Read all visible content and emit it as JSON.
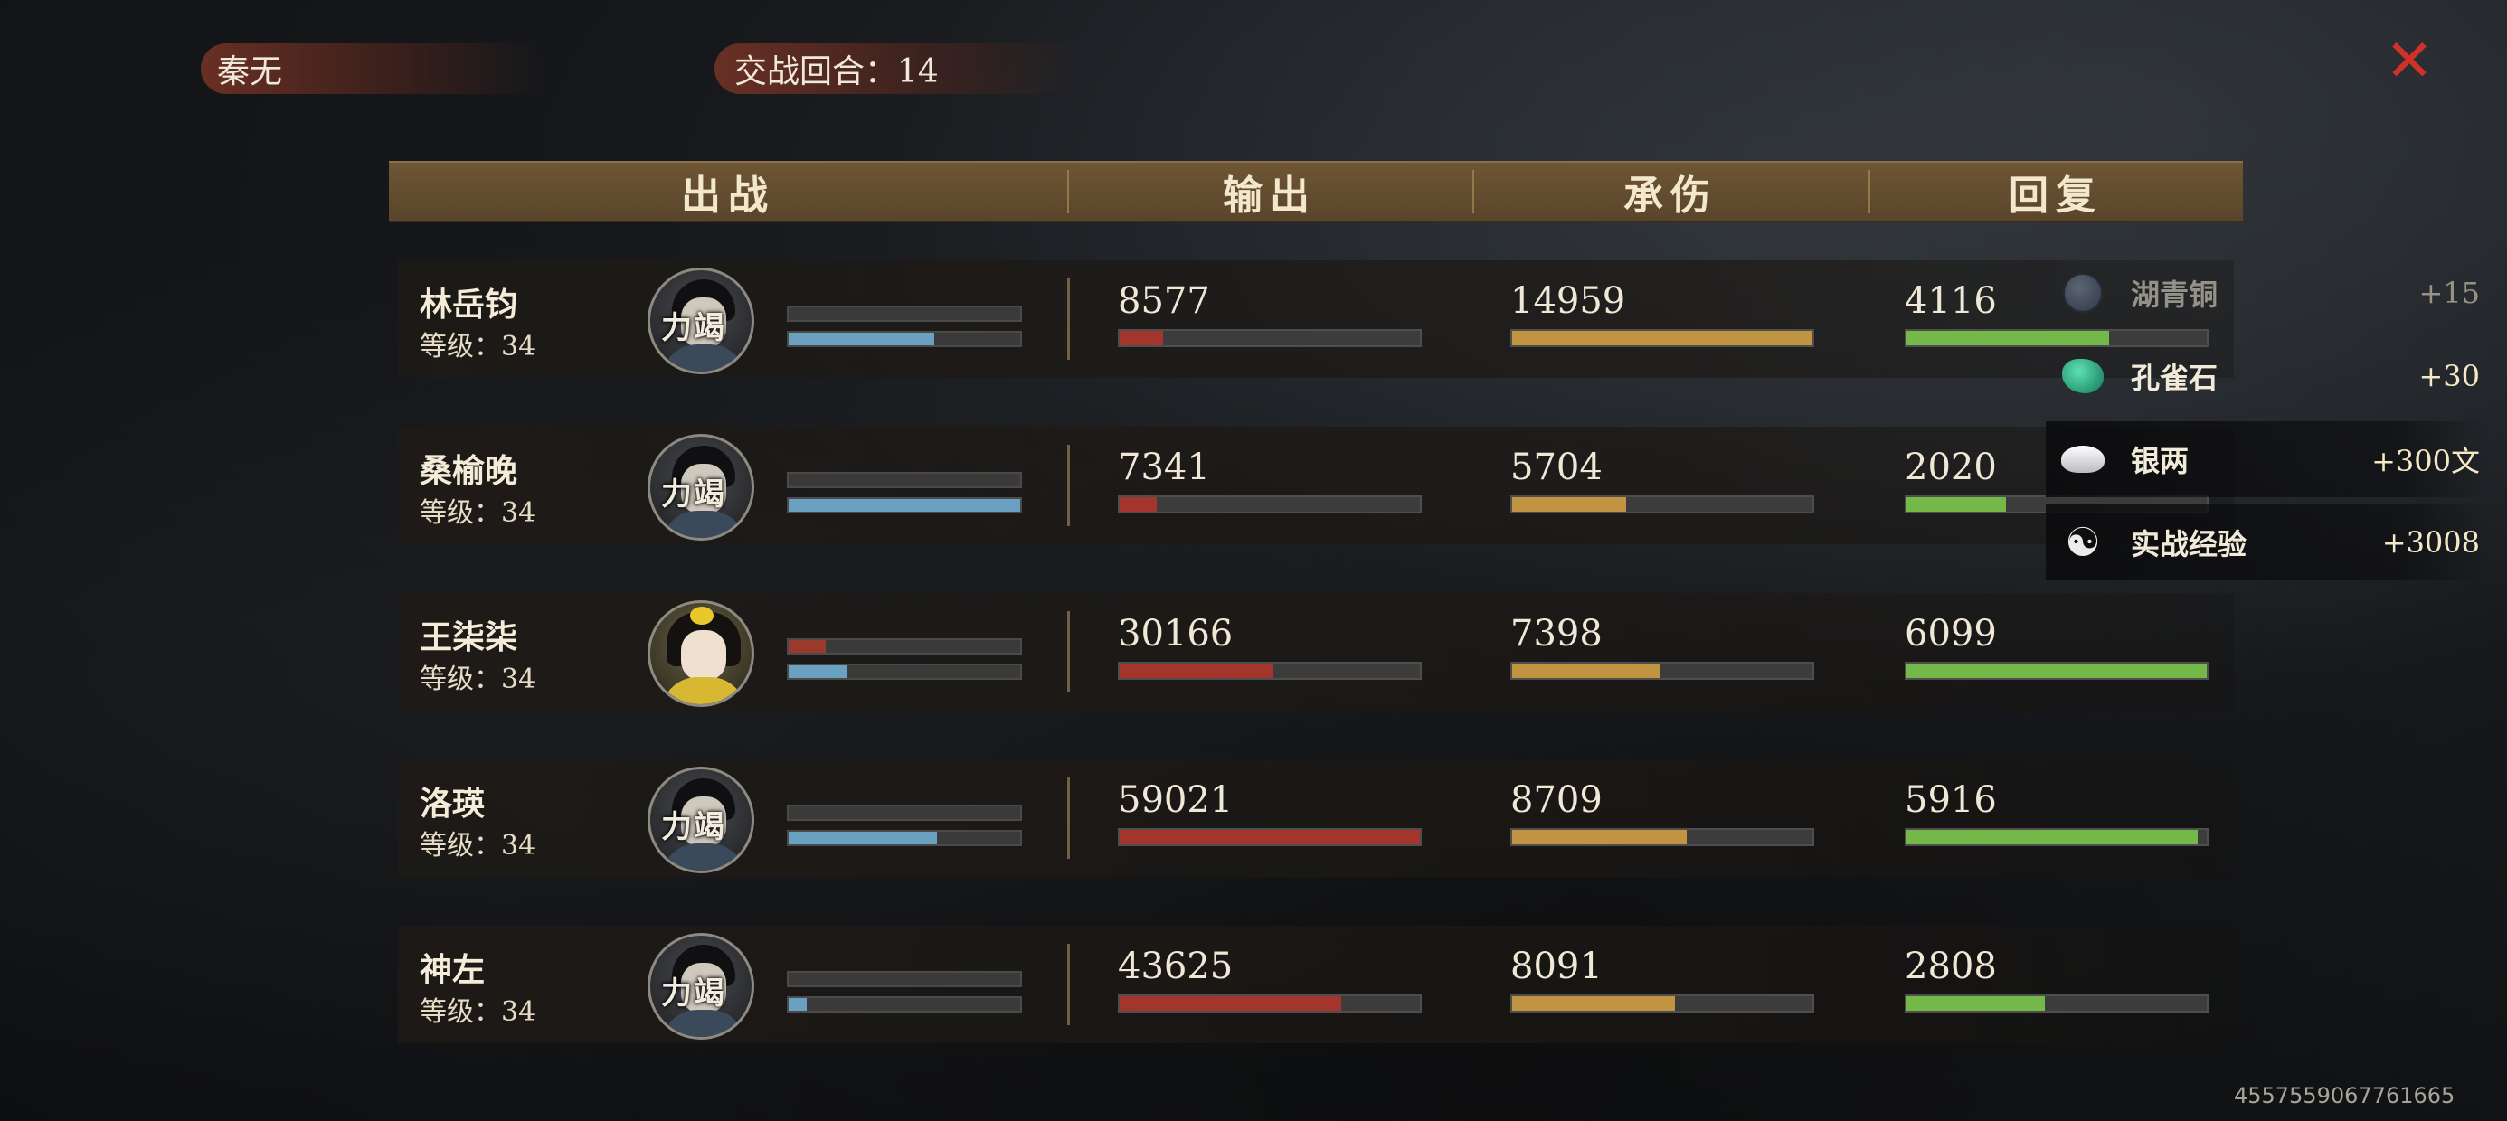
{
  "player": {
    "name": "秦无"
  },
  "battle": {
    "rounds_label": "交战回合：14"
  },
  "close_icon": "✕",
  "headers": [
    "出战",
    "输出",
    "承伤",
    "回复"
  ],
  "colors": {
    "output": "#a4352d",
    "tank": "#c19442",
    "heal": "#74b84a",
    "mini_red": "#9a3a2c",
    "mini_blue": "#6aa0c0"
  },
  "rows": [
    {
      "name": "林岳钧",
      "level": "等级：34",
      "avatar_mark": "力竭",
      "avatar_type": "male",
      "mini_top": 0,
      "mini_bot": 0.63,
      "output": "8577",
      "output_pct": 0.145,
      "tank": "14959",
      "tank_pct": 1.0,
      "heal": "4116",
      "heal_pct": 0.675
    },
    {
      "name": "桑榆晚",
      "level": "等级：34",
      "avatar_mark": "力竭",
      "avatar_type": "male",
      "mini_top": 0,
      "mini_bot": 1.0,
      "output": "7341",
      "output_pct": 0.124,
      "tank": "5704",
      "tank_pct": 0.381,
      "heal": "2020",
      "heal_pct": 0.331
    },
    {
      "name": "王柒柒",
      "level": "等级：34",
      "avatar_mark": "",
      "avatar_type": "female",
      "mini_top": 0.16,
      "mini_bot": 0.25,
      "output": "30166",
      "output_pct": 0.511,
      "tank": "7398",
      "tank_pct": 0.495,
      "heal": "6099",
      "heal_pct": 1.0
    },
    {
      "name": "洛瑛",
      "level": "等级：34",
      "avatar_mark": "力竭",
      "avatar_type": "male",
      "mini_top": 0,
      "mini_bot": 0.64,
      "output": "59021",
      "output_pct": 1.0,
      "tank": "8709",
      "tank_pct": 0.582,
      "heal": "5916",
      "heal_pct": 0.97
    },
    {
      "name": "神左",
      "level": "等级：34",
      "avatar_mark": "力竭",
      "avatar_type": "male",
      "mini_top": 0,
      "mini_bot": 0.08,
      "output": "43625",
      "output_pct": 0.739,
      "tank": "8091",
      "tank_pct": 0.541,
      "heal": "2808",
      "heal_pct": 0.46
    }
  ],
  "rewards": [
    {
      "label": "湖青铜",
      "amount": "+15",
      "icon": "bronze-icon",
      "dim": true,
      "highlight": false
    },
    {
      "label": "孔雀石",
      "amount": "+30",
      "icon": "jade-icon",
      "dim": false,
      "highlight": false
    },
    {
      "label": "银两",
      "amount": "+300文",
      "icon": "silver-ingot-icon",
      "dim": false,
      "highlight": true
    },
    {
      "label": "实战经验",
      "amount": "+3008",
      "icon": "experience-icon",
      "dim": false,
      "highlight": true
    }
  ],
  "uid": "4557559067761665"
}
